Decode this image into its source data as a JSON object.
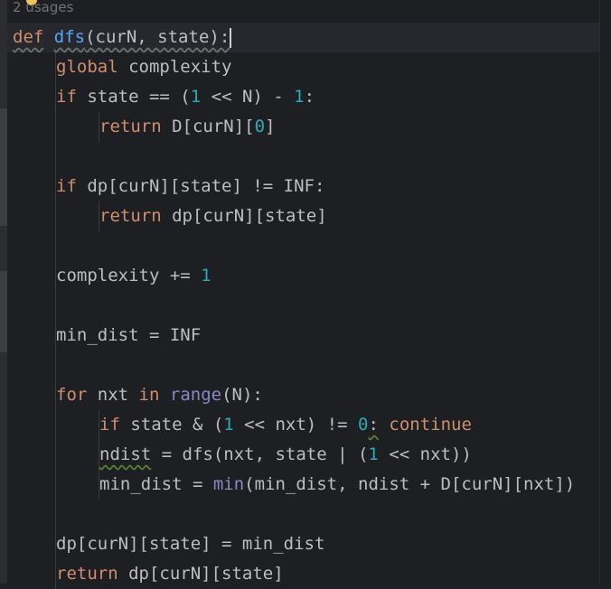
{
  "editor": {
    "usages_hint": "2 usages",
    "lines": [
      {
        "tokens": [
          {
            "t": "def",
            "c": "kw wavy-kw"
          },
          {
            "t": " ",
            "c": "plain"
          },
          {
            "t": "dfs",
            "c": "fn wavy-kw"
          },
          {
            "t": "(curN, state):",
            "c": "plain wavy-kw"
          }
        ],
        "indent": 0,
        "caret": true
      },
      {
        "tokens": [
          {
            "t": "global",
            "c": "kw"
          },
          {
            "t": " complexity",
            "c": "plain"
          }
        ],
        "indent": 1
      },
      {
        "tokens": [
          {
            "t": "if",
            "c": "kw"
          },
          {
            "t": " state == (",
            "c": "plain"
          },
          {
            "t": "1",
            "c": "num"
          },
          {
            "t": " << N) - ",
            "c": "plain"
          },
          {
            "t": "1",
            "c": "num"
          },
          {
            "t": ":",
            "c": "plain"
          }
        ],
        "indent": 1
      },
      {
        "tokens": [
          {
            "t": "return",
            "c": "kw"
          },
          {
            "t": " D[curN][",
            "c": "plain"
          },
          {
            "t": "0",
            "c": "num"
          },
          {
            "t": "]",
            "c": "plain"
          }
        ],
        "indent": 2
      },
      {
        "tokens": [],
        "indent": 0
      },
      {
        "tokens": [
          {
            "t": "if",
            "c": "kw"
          },
          {
            "t": " dp[curN][state] != INF:",
            "c": "plain"
          }
        ],
        "indent": 1
      },
      {
        "tokens": [
          {
            "t": "return",
            "c": "kw"
          },
          {
            "t": " dp[curN][state]",
            "c": "plain"
          }
        ],
        "indent": 2
      },
      {
        "tokens": [],
        "indent": 0
      },
      {
        "tokens": [
          {
            "t": "complexity += ",
            "c": "plain"
          },
          {
            "t": "1",
            "c": "num"
          }
        ],
        "indent": 1
      },
      {
        "tokens": [],
        "indent": 0
      },
      {
        "tokens": [
          {
            "t": "min_dist = INF",
            "c": "plain"
          }
        ],
        "indent": 1
      },
      {
        "tokens": [],
        "indent": 0
      },
      {
        "tokens": [
          {
            "t": "for",
            "c": "kw"
          },
          {
            "t": " nxt ",
            "c": "plain"
          },
          {
            "t": "in",
            "c": "kw"
          },
          {
            "t": " ",
            "c": "plain"
          },
          {
            "t": "range",
            "c": "bi"
          },
          {
            "t": "(N):",
            "c": "plain"
          }
        ],
        "indent": 1
      },
      {
        "tokens": [
          {
            "t": "if",
            "c": "kw"
          },
          {
            "t": " state & (",
            "c": "plain"
          },
          {
            "t": "1",
            "c": "num"
          },
          {
            "t": " << nxt) != ",
            "c": "plain"
          },
          {
            "t": "0",
            "c": "num"
          },
          {
            "t": ":",
            "c": "plain wavy"
          },
          {
            "t": " ",
            "c": "plain"
          },
          {
            "t": "continue",
            "c": "kw"
          }
        ],
        "indent": 2
      },
      {
        "tokens": [
          {
            "t": "ndist",
            "c": "plain wavy"
          },
          {
            "t": " = dfs(nxt, state | (",
            "c": "plain"
          },
          {
            "t": "1",
            "c": "num"
          },
          {
            "t": " << nxt))",
            "c": "plain"
          }
        ],
        "indent": 2
      },
      {
        "tokens": [
          {
            "t": "min_dist = ",
            "c": "plain"
          },
          {
            "t": "min",
            "c": "bi"
          },
          {
            "t": "(min_dist, ndist + D[curN][nxt])",
            "c": "plain"
          }
        ],
        "indent": 2
      },
      {
        "tokens": [],
        "indent": 0
      },
      {
        "tokens": [
          {
            "t": "dp[curN][state] = min_dist",
            "c": "plain"
          }
        ],
        "indent": 1
      },
      {
        "tokens": [
          {
            "t": "return",
            "c": "kw"
          },
          {
            "t": " dp[curN][state]",
            "c": "plain"
          }
        ],
        "indent": 1
      }
    ]
  },
  "colors": {
    "background": "#1e1f22",
    "keyword": "#cf8e6d",
    "function": "#56a8f5",
    "number": "#2aacb8",
    "builtin": "#8888c6",
    "text": "#bcbec4"
  }
}
